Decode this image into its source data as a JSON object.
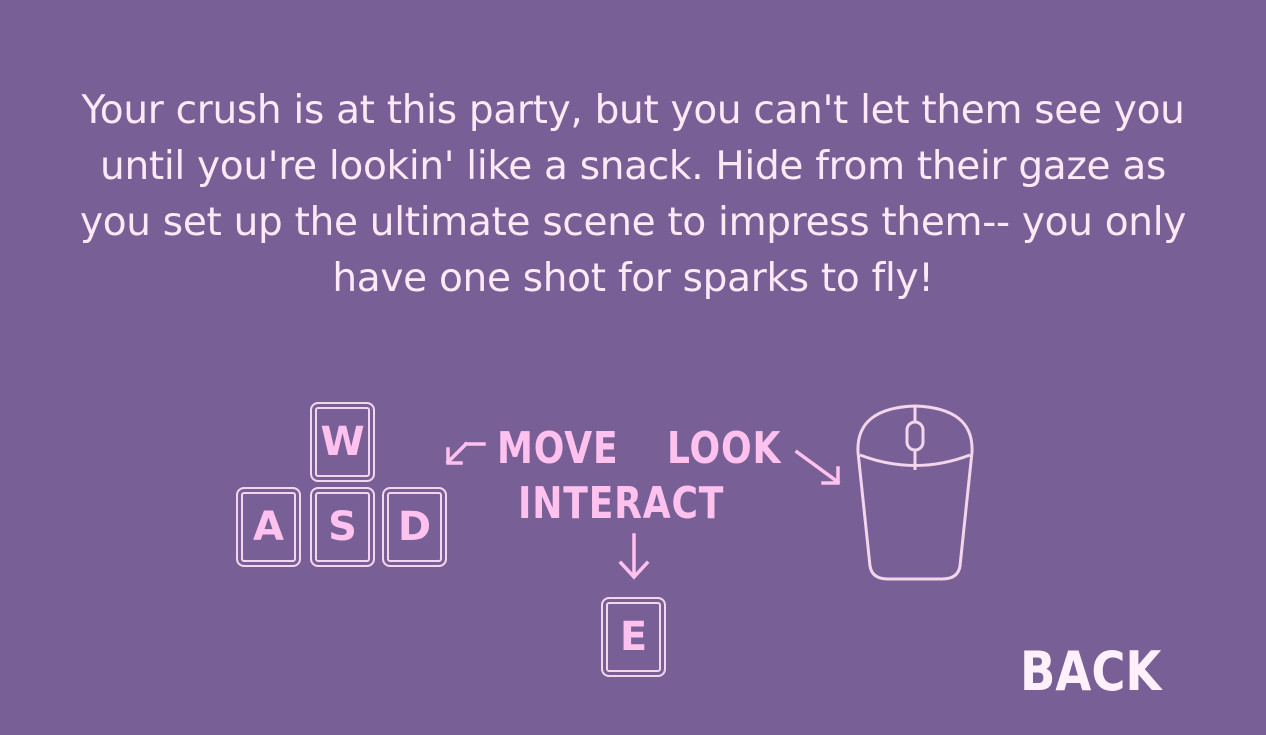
{
  "intro_text": "Your crush is at this party, but you can't let them see you until you're lookin' like a snack. Hide from their gaze as you set up the ultimate scene to impress them-- you only have one shot for sparks to fly!",
  "keys": {
    "w": "W",
    "a": "A",
    "s": "S",
    "d": "D",
    "e": "E"
  },
  "labels": {
    "move": "MOVE",
    "look": "LOOK",
    "interact": "INTERACT"
  },
  "icons": {
    "mouse": "mouse-icon",
    "move_arrow": "arrow-down-left-icon",
    "look_arrow": "arrow-down-right-icon",
    "interact_arrow": "arrow-down-icon"
  },
  "back_label": "BACK",
  "colors": {
    "background": "#785f96",
    "text": "#fde8f6",
    "accent": "#ffc2ee",
    "outline": "#f4d6ec"
  }
}
